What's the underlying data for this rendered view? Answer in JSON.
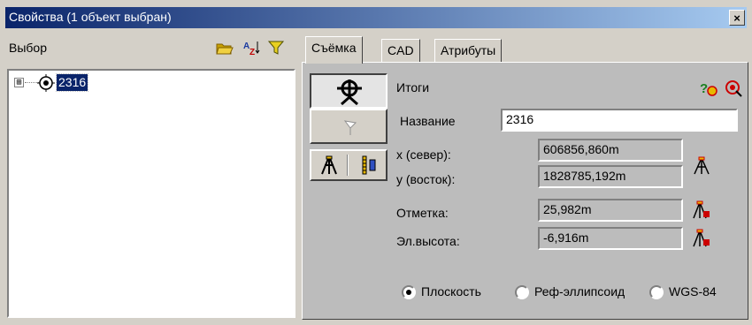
{
  "window": {
    "title": "Свойства (1 объект выбран)",
    "close_glyph": "×"
  },
  "left_panel": {
    "label": "Выбор",
    "icons": [
      "open-folder-icon",
      "sort-az-icon",
      "filter-icon"
    ],
    "tree": {
      "expander": "⊞",
      "node_icon": "survey-point-icon",
      "node_label": "2316",
      "selected": true
    }
  },
  "tabs": [
    {
      "label": "Съёмка",
      "active": true
    },
    {
      "label": "CAD",
      "active": false
    },
    {
      "label": "Атрибуты",
      "active": false
    }
  ],
  "survey": {
    "section_title": "Итоги",
    "header_icons": [
      "help-icon",
      "target-icon"
    ],
    "mode_buttons": [
      "total-station-icon",
      "flag-icon",
      "tripod-icon",
      "survey-rod-icon"
    ],
    "name_label": "Название",
    "name_value": "2316",
    "x_label": "x (север):",
    "x_value": "606856,860m",
    "y_label": "у (восток):",
    "y_value": "1828785,192m",
    "elev_label": "Отметка:",
    "elev_value": "25,982m",
    "ell_label": "Эл.высота:",
    "ell_value": "-6,916m",
    "radios": [
      {
        "label": "Плоскость",
        "selected": true
      },
      {
        "label": "Реф-эллипсоид",
        "selected": false
      },
      {
        "label": "WGS-84",
        "selected": false
      }
    ]
  },
  "colors": {
    "titlebar_start": "#0a246a",
    "titlebar_end": "#a6caf0",
    "selection": "#0a246a",
    "icon_red": "#cc0000",
    "icon_yellow": "#e8b800"
  }
}
